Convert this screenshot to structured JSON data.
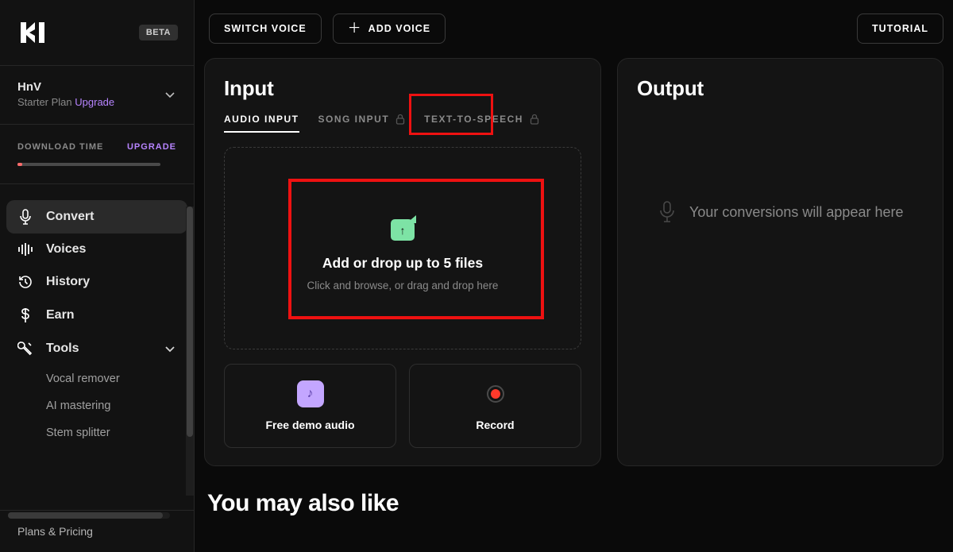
{
  "beta_badge": "BETA",
  "account": {
    "name": "HnV",
    "plan_prefix": "Starter Plan ",
    "upgrade": "Upgrade"
  },
  "download": {
    "label": "DOWNLOAD TIME",
    "upgrade": "UPGRADE"
  },
  "nav": {
    "convert": "Convert",
    "voices": "Voices",
    "history": "History",
    "earn": "Earn",
    "tools": "Tools",
    "tools_sub": {
      "vocal": "Vocal remover",
      "mastering": "AI mastering",
      "stem": "Stem splitter"
    }
  },
  "bottom": {
    "plans": "Plans & Pricing"
  },
  "topbar": {
    "switch": "SWITCH VOICE",
    "add": "ADD VOICE",
    "tutorial": "TUTORIAL"
  },
  "input": {
    "heading": "Input",
    "tabs": {
      "audio": "AUDIO INPUT",
      "song": "SONG INPUT",
      "tts": "TEXT-TO-SPEECH"
    },
    "drop_title": "Add or drop up to 5 files",
    "drop_sub": "Click and browse, or drag and drop here",
    "demo": "Free demo audio",
    "record": "Record"
  },
  "output": {
    "heading": "Output",
    "empty": "Your conversions will appear here"
  },
  "also_like": "You may also like"
}
